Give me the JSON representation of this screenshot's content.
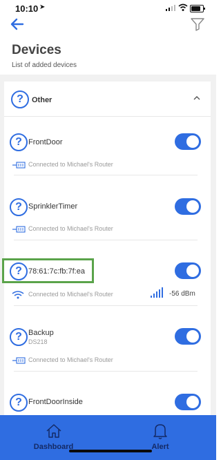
{
  "status_bar": {
    "time": "10:10",
    "location_glyph": "➤"
  },
  "header": {
    "title": "Devices",
    "subtitle": "List of added devices"
  },
  "group": {
    "label": "Other"
  },
  "devices": [
    {
      "name": "FrontDoor",
      "connection": "Connected to  Michael's Router",
      "toggle_on": true
    },
    {
      "name": "SprinklerTimer",
      "connection": "Connected to  Michael's Router",
      "toggle_on": true
    },
    {
      "name": "78:61:7c:fb:7f:ea",
      "connection": "Connected to  Michael's Router",
      "signal": "-56  dBm",
      "toggle_on": true
    },
    {
      "name": "Backup",
      "subtitle": "DS218",
      "connection": "Connected to  Michael's Router",
      "toggle_on": true
    },
    {
      "name": "FrontDoorInside",
      "toggle_on": true
    }
  ],
  "tabs": [
    {
      "label": "Dashboard",
      "icon": "home-icon"
    },
    {
      "label": "Alert",
      "icon": "bell-icon"
    }
  ],
  "colors": {
    "accent": "#2f6de1",
    "highlight": "#5aa34a",
    "tab_text": "#142a66"
  },
  "icons": {
    "question": "?"
  }
}
